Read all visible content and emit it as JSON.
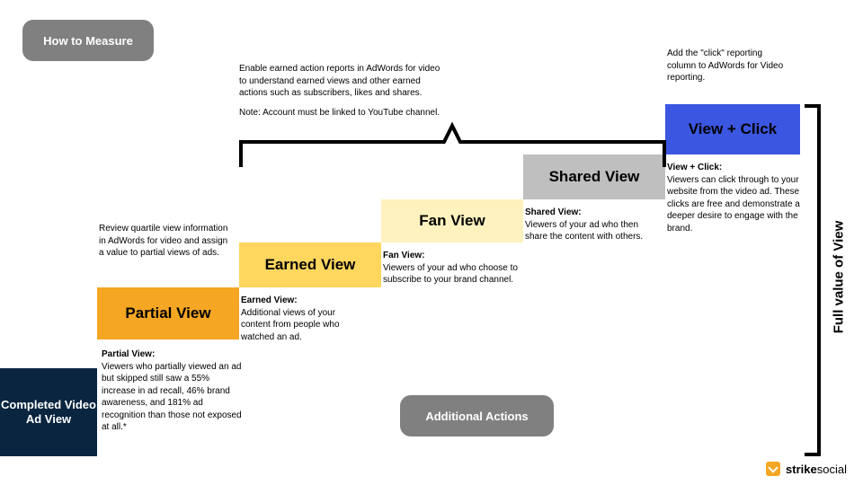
{
  "pills": {
    "howToMeasure": "How to Measure",
    "additionalActions": "Additional Actions"
  },
  "base": "Completed Video Ad View",
  "steps": {
    "partial": "Partial View",
    "earned": "Earned View",
    "fan": "Fan View",
    "shared": "Shared View",
    "viewClick": "View + Click"
  },
  "topNotes": {
    "partial": "Review quartile view information in AdWords for video and assign a value to partial views of ads.",
    "earned_p1": "Enable earned action reports in AdWords for video to understand earned views and other earned actions such as subscribers, likes and shares.",
    "earned_p2": "Note: Account must be linked to YouTube channel.",
    "viewClick": "Add the \"click\" reporting column to AdWords for Video reporting."
  },
  "descriptions": {
    "partial": {
      "title": "Partial View:",
      "body": "Viewers who partially viewed an ad but skipped still saw a 55% increase in ad recall, 46% brand awareness, and 181% ad recognition than those not exposed at all.*"
    },
    "earned": {
      "title": "Earned View:",
      "body": "Additional views of your content from people who watched an ad."
    },
    "fan": {
      "title": "Fan View:",
      "body": "Viewers of your ad who choose to subscribe to your brand channel."
    },
    "shared": {
      "title": "Shared View:",
      "body": "Viewers of your ad who then share the content with others."
    },
    "viewClick": {
      "title": "View + Click:",
      "body": "Viewers can click through to your website from the video ad. These clicks are free and demonstrate a deeper desire to engage with the brand."
    }
  },
  "rightLabel": "Full value of View",
  "brand": {
    "a": "strike",
    "b": "social"
  },
  "chart_data": {
    "type": "table",
    "title": "Video Ad View Value Staircase",
    "stages": [
      {
        "name": "Partial View",
        "definition": "Viewers who partially viewed an ad but skipped still saw a 55% increase in ad recall, 46% brand awareness, and 181% ad recognition than those not exposed at all.",
        "measurement": "Review quartile view information in AdWords for video and assign a value to partial views of ads."
      },
      {
        "name": "Earned View",
        "definition": "Additional views of your content from people who watched an ad.",
        "measurement": "Enable earned action reports in AdWords for video (account must be linked to YouTube channel)."
      },
      {
        "name": "Fan View",
        "definition": "Viewers of your ad who choose to subscribe to your brand channel.",
        "measurement": "Enable earned action reports in AdWords for video (account must be linked to YouTube channel)."
      },
      {
        "name": "Shared View",
        "definition": "Viewers of your ad who then share the content with others.",
        "measurement": "Enable earned action reports in AdWords for video (account must be linked to YouTube channel)."
      },
      {
        "name": "View + Click",
        "definition": "Viewers can click through to your website from the video ad. These clicks are free and demonstrate a deeper desire to engage with the brand.",
        "measurement": "Add the \"click\" reporting column to AdWords for Video reporting."
      }
    ],
    "base_stage": "Completed Video Ad View",
    "grand_total_label": "Full value of View"
  }
}
